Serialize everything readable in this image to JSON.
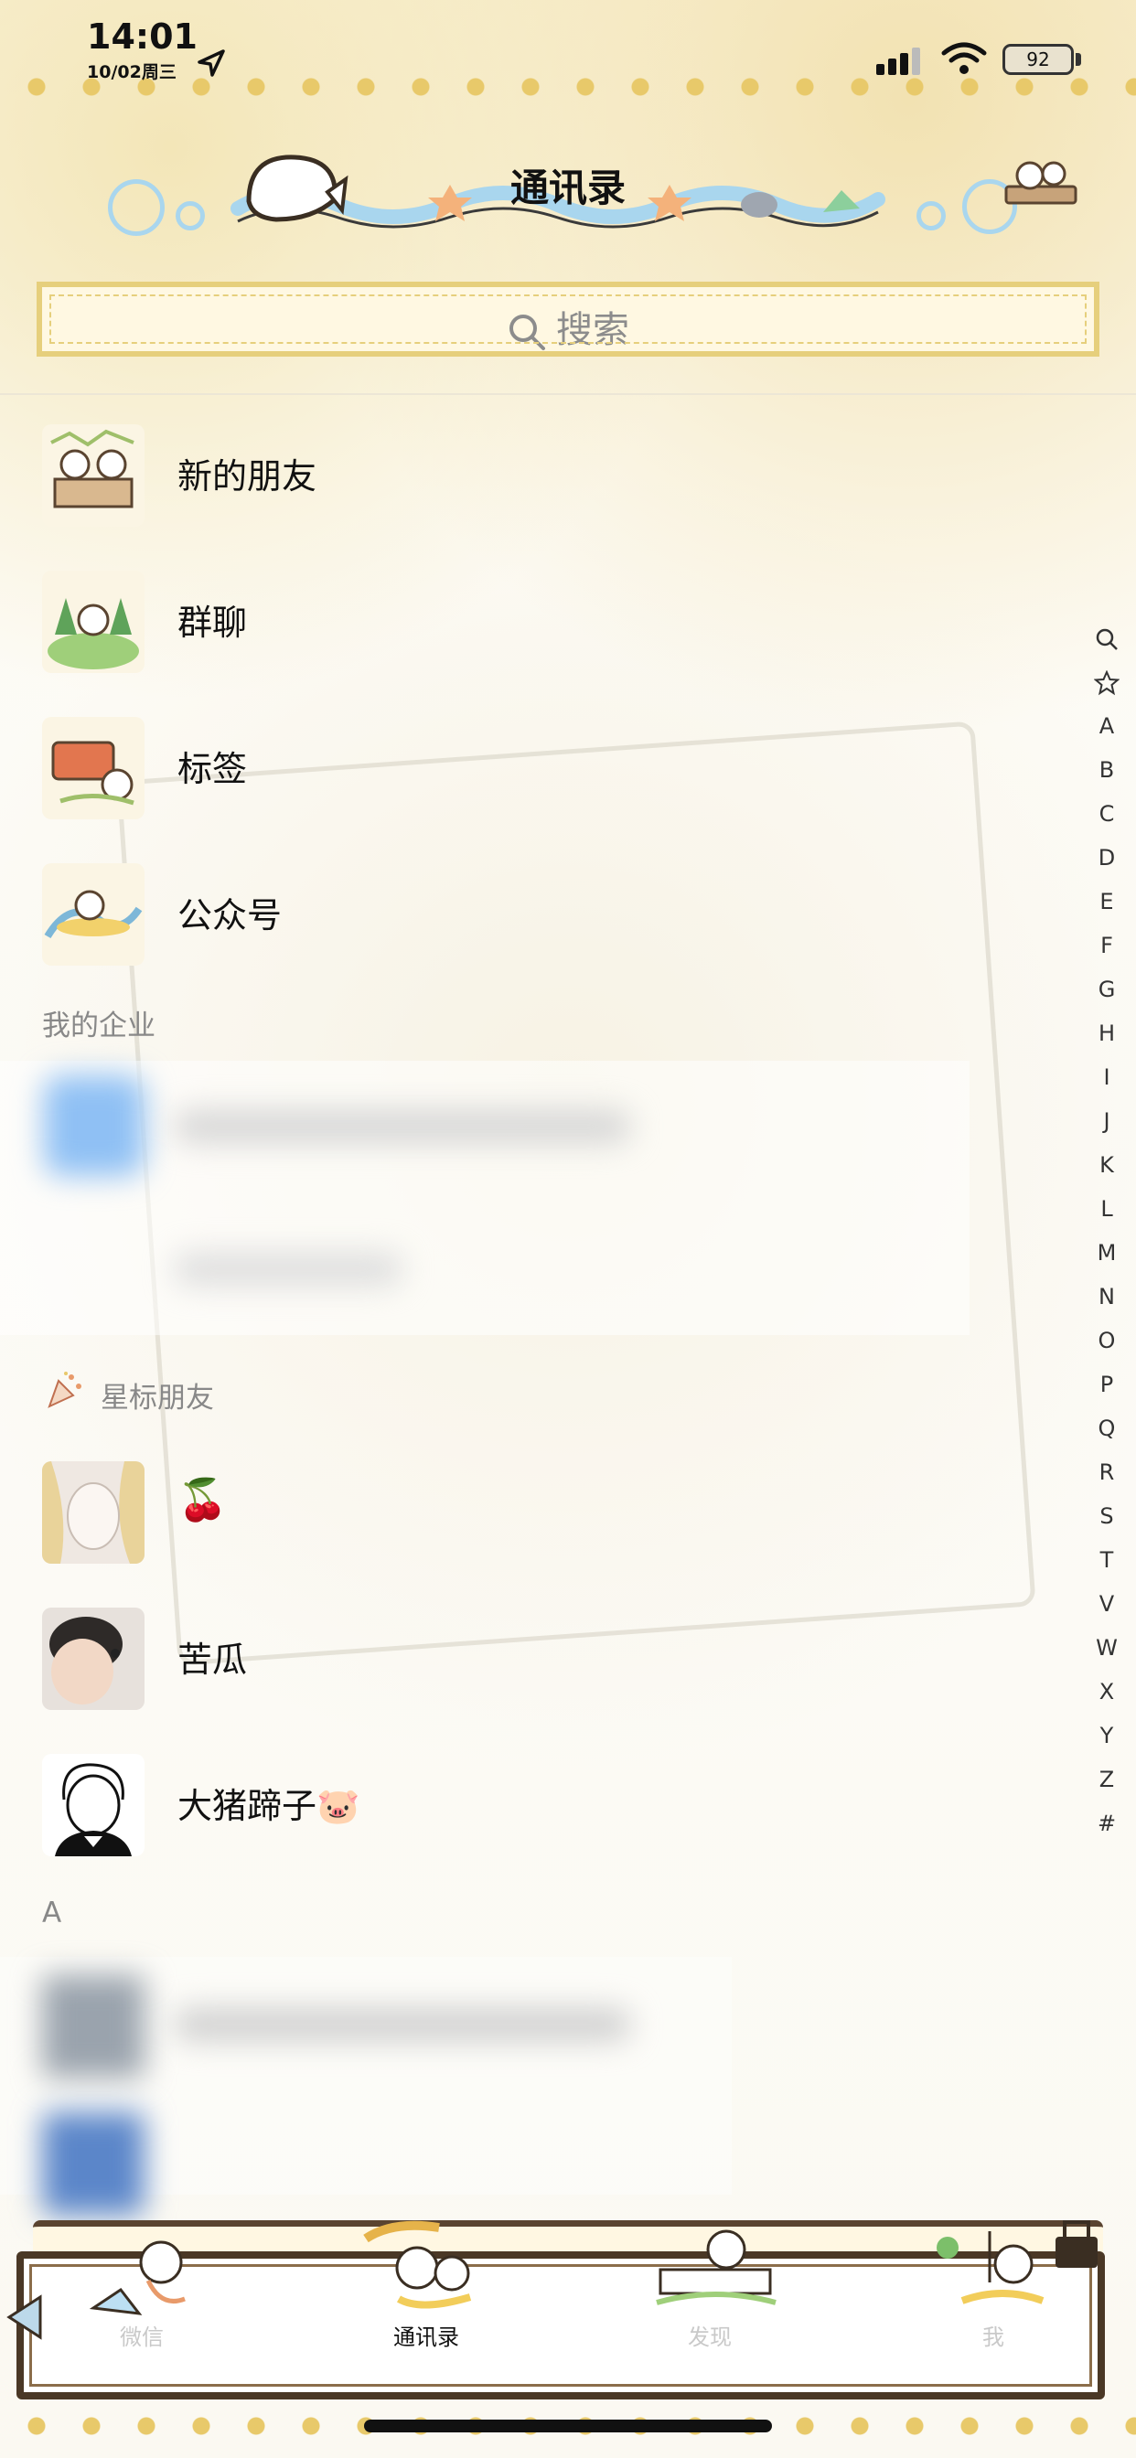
{
  "status_bar": {
    "time": "14:01",
    "date": "10/02周三",
    "battery": "92"
  },
  "header": {
    "title": "通讯录"
  },
  "search": {
    "placeholder": "搜索"
  },
  "entries": [
    {
      "label": "新的朋友",
      "icon": "cats-picnic-sticker"
    },
    {
      "label": "群聊",
      "icon": "cats-forest-sticker"
    },
    {
      "label": "标签",
      "icon": "cats-bbq-sticker"
    },
    {
      "label": "公众号",
      "icon": "cat-surf-sticker"
    }
  ],
  "sections": {
    "enterprise": "我的企业",
    "starred": "星标朋友",
    "letter_a": "A"
  },
  "starred_contacts": [
    {
      "name": "🍒"
    },
    {
      "name": "苦瓜"
    },
    {
      "name": "大猪蹄子🐷"
    }
  ],
  "index_letters": [
    "Q",
    "☆",
    "A",
    "B",
    "C",
    "D",
    "E",
    "F",
    "G",
    "H",
    "I",
    "J",
    "K",
    "L",
    "M",
    "N",
    "O",
    "P",
    "Q",
    "R",
    "S",
    "T",
    "V",
    "W",
    "X",
    "Y",
    "Z",
    "#"
  ],
  "index_icons": {
    "search": "search-icon",
    "star": "star-icon"
  },
  "tabs": [
    {
      "label": "微信",
      "active": false
    },
    {
      "label": "通讯录",
      "active": true
    },
    {
      "label": "发现",
      "active": false
    },
    {
      "label": "我",
      "active": false
    }
  ],
  "colors": {
    "accent_gold": "#e6cf7c",
    "tab_active": "#111111",
    "tab_inactive": "#c9c9c9",
    "frame_brown": "#4a3826"
  }
}
